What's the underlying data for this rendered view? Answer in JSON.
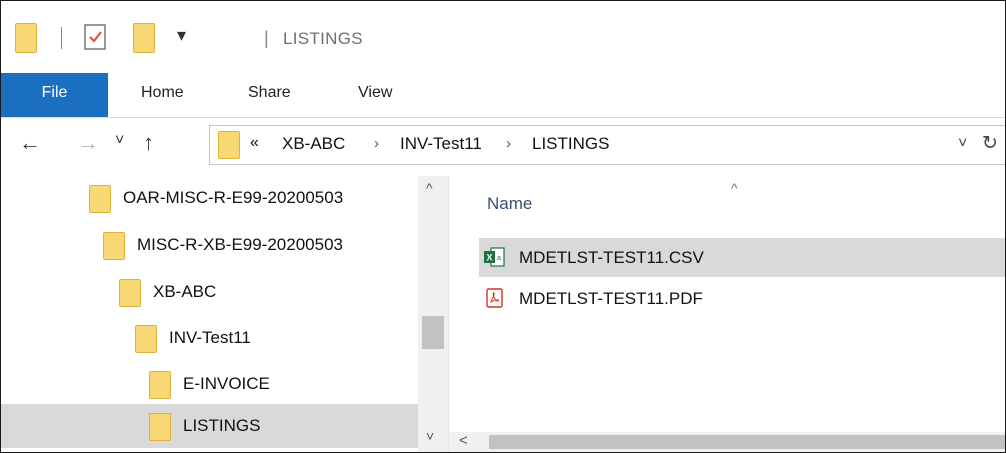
{
  "window": {
    "title": "LISTINGS",
    "title_separator": "|",
    "customize_toolbar_glyph": "▾"
  },
  "ribbon": {
    "tabs": [
      {
        "label": "File"
      },
      {
        "label": "Home"
      },
      {
        "label": "Share"
      },
      {
        "label": "View"
      }
    ],
    "accent_color": "#1a6fc0"
  },
  "navigation": {
    "back_icon": "←",
    "forward_icon": "→",
    "recent_icon": "˅",
    "up_icon": "↑",
    "overflow_chevron": "«",
    "breadcrumbs": [
      "XB-ABC",
      "INV-Test11",
      "LISTINGS"
    ],
    "crumb_separator": "›",
    "dropdown_icon": "˅",
    "refresh_icon": "↻"
  },
  "tree": {
    "items": [
      {
        "label": "OAR-MISC-R-E99-20200503",
        "selected": false
      },
      {
        "label": "MISC-R-XB-E99-20200503",
        "selected": false
      },
      {
        "label": "XB-ABC",
        "selected": false
      },
      {
        "label": "INV-Test11",
        "selected": false
      },
      {
        "label": "E-INVOICE",
        "selected": false
      },
      {
        "label": "LISTINGS",
        "selected": true
      }
    ],
    "scroll_up_icon": "^",
    "scroll_down_icon": "˅"
  },
  "files": {
    "column_header": "Name",
    "sort_indicator": "^",
    "items": [
      {
        "name": "MDETLST-TEST11.CSV",
        "icon": "excel-csv-icon",
        "selected": true
      },
      {
        "name": "MDETLST-TEST11.PDF",
        "icon": "pdf-icon",
        "selected": false
      }
    ],
    "hscroll_left_icon": "<"
  },
  "colors": {
    "selection": "#d9d9d9",
    "folder": "#f8d775",
    "excel_green": "#1e7145",
    "pdf_red": "#d93025"
  }
}
